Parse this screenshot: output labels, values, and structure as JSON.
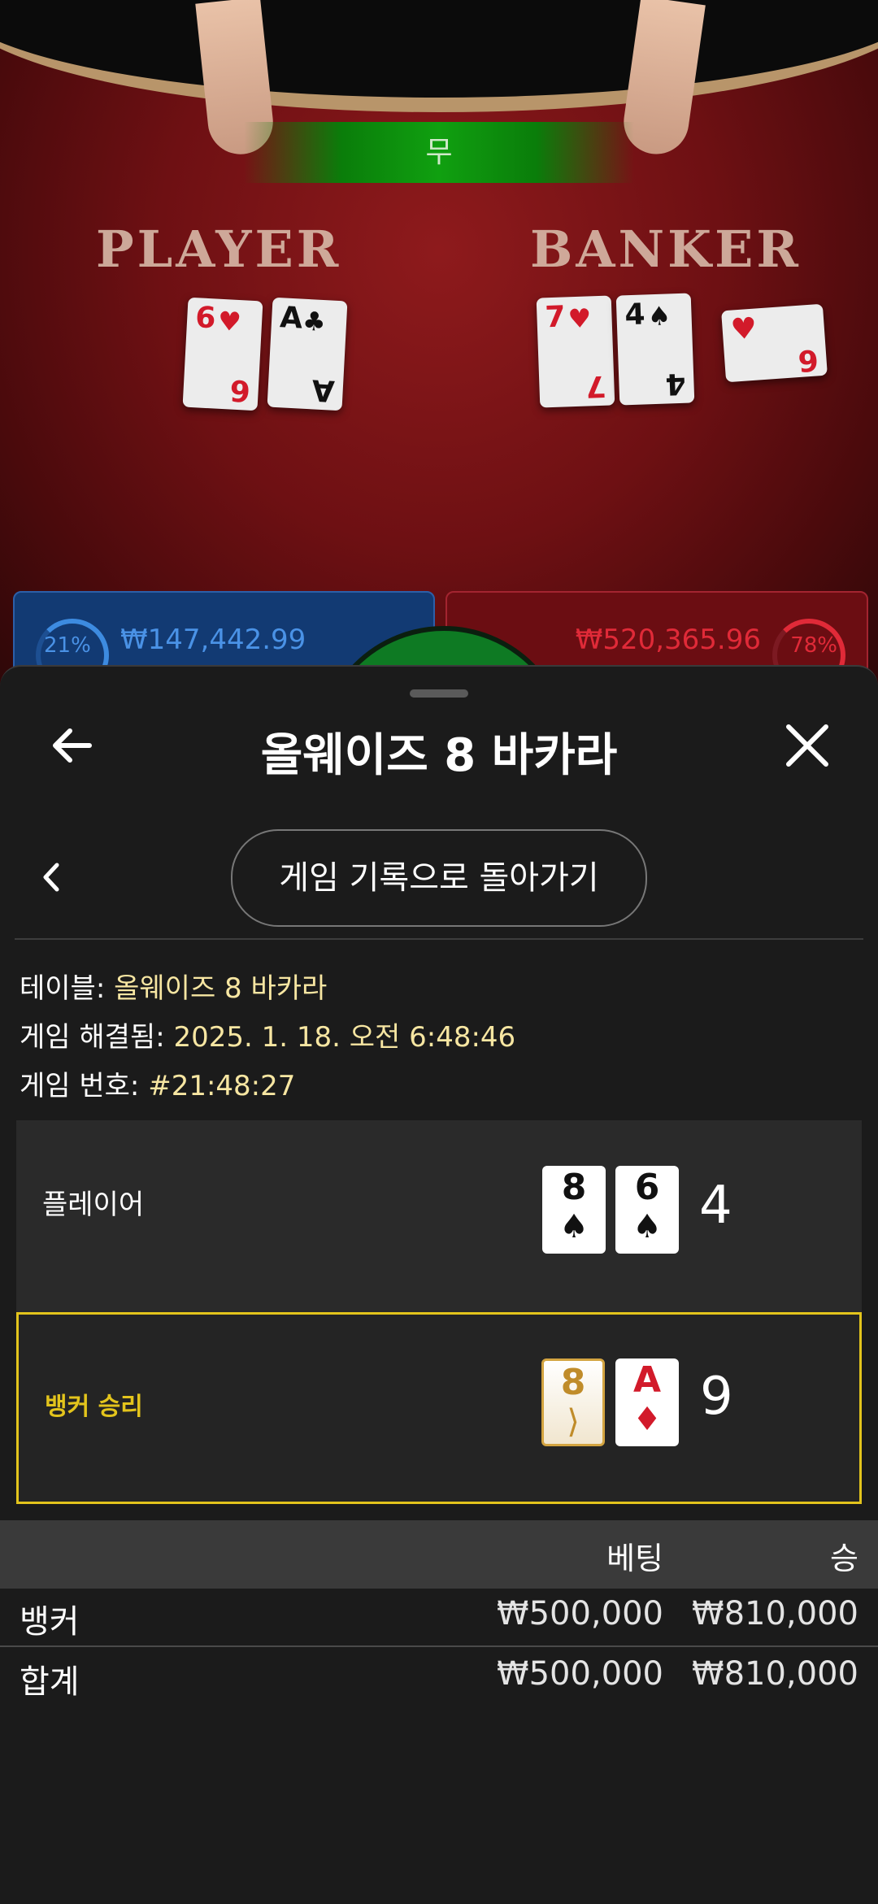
{
  "video": {
    "tie_banner": "무",
    "player_label": "PLAYER",
    "banker_label": "BANKER",
    "player_pct": "21%",
    "player_amount": "₩147,442.99",
    "banker_pct": "78%",
    "banker_amount": "₩520,365.96",
    "player_cards": [
      {
        "rank": "6",
        "suit": "♥",
        "color": "red"
      },
      {
        "rank": "A",
        "suit": "♣",
        "color": "black"
      }
    ],
    "banker_cards": [
      {
        "rank": "7",
        "suit": "♥",
        "color": "red"
      },
      {
        "rank": "4",
        "suit": "♠",
        "color": "black"
      },
      {
        "rank": "6",
        "suit": "♥",
        "color": "red"
      }
    ]
  },
  "header": {
    "title": "올웨이즈 8 바카라",
    "back_icon": "arrow-left-icon",
    "close_icon": "close-icon"
  },
  "nav": {
    "back_to_history": "게임 기록으로 돌아가기",
    "chevron_icon": "chevron-left-icon"
  },
  "info": {
    "table_label": "테이블:",
    "table_value": "올웨이즈 8 바카라",
    "resolved_label": "게임 해결됨:",
    "resolved_value": "2025. 1. 18. 오전 6:48:46",
    "game_no_label": "게임 번호:",
    "game_no_value": "#21:48:27"
  },
  "results": {
    "player": {
      "label": "플레이어",
      "score": "4",
      "cards": [
        {
          "rank": "8",
          "suit": "♠",
          "color": "black"
        },
        {
          "rank": "6",
          "suit": "♠",
          "color": "black"
        }
      ]
    },
    "banker": {
      "label": "뱅커 승리",
      "score": "9",
      "cards": [
        {
          "rank": "8",
          "suit": "⟩",
          "color": "gold"
        },
        {
          "rank": "A",
          "suit": "♦",
          "color": "red"
        }
      ]
    }
  },
  "bets": {
    "headers": {
      "bet": "베팅",
      "win": "승"
    },
    "rows": [
      {
        "name": "뱅커",
        "bet": "₩500,000",
        "win": "₩810,000"
      }
    ],
    "total": {
      "name": "합계",
      "bet": "₩500,000",
      "win": "₩810,000"
    }
  },
  "colors": {
    "accent_gold": "#e3c41c",
    "highlight_text": "#f7e6a2",
    "player_blue": "#2c5fa8",
    "banker_red": "#a32430",
    "tie_green": "#10a010"
  }
}
